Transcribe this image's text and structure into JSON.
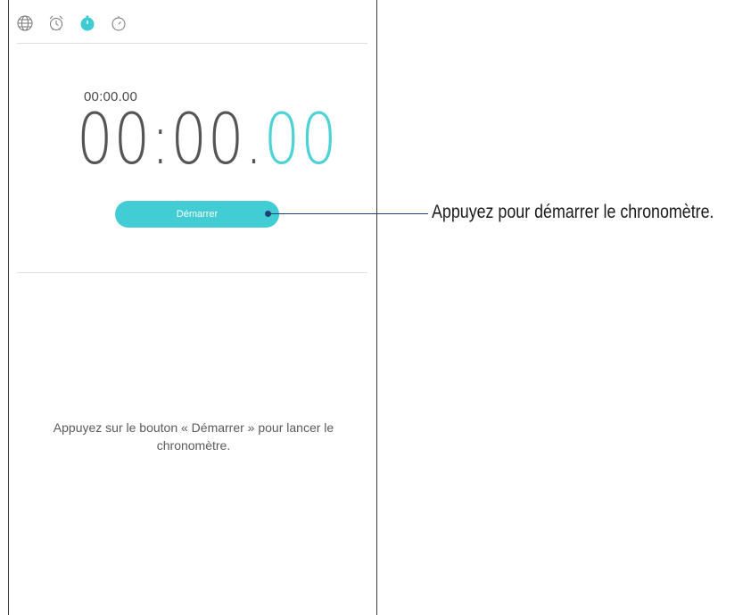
{
  "tabs": [
    {
      "icon": "globe-icon",
      "label": "World clock"
    },
    {
      "icon": "alarm-icon",
      "label": "Alarm"
    },
    {
      "icon": "stopwatch-icon",
      "label": "Stopwatch",
      "active": true
    },
    {
      "icon": "timer-icon",
      "label": "Timer"
    }
  ],
  "stopwatch": {
    "lap_time": "00:00.00",
    "main_time_main": "00:00.",
    "main_time_hundredths": "00"
  },
  "start_button": {
    "label": "Démarrer"
  },
  "hint_text": "Appuyez sur le bouton « Démarrer » pour lancer le chronomètre.",
  "callout": {
    "text": "Appuyez pour démarrer le chronomètre."
  },
  "colors": {
    "accent": "#42ccd4",
    "callout": "#1f3f78"
  }
}
